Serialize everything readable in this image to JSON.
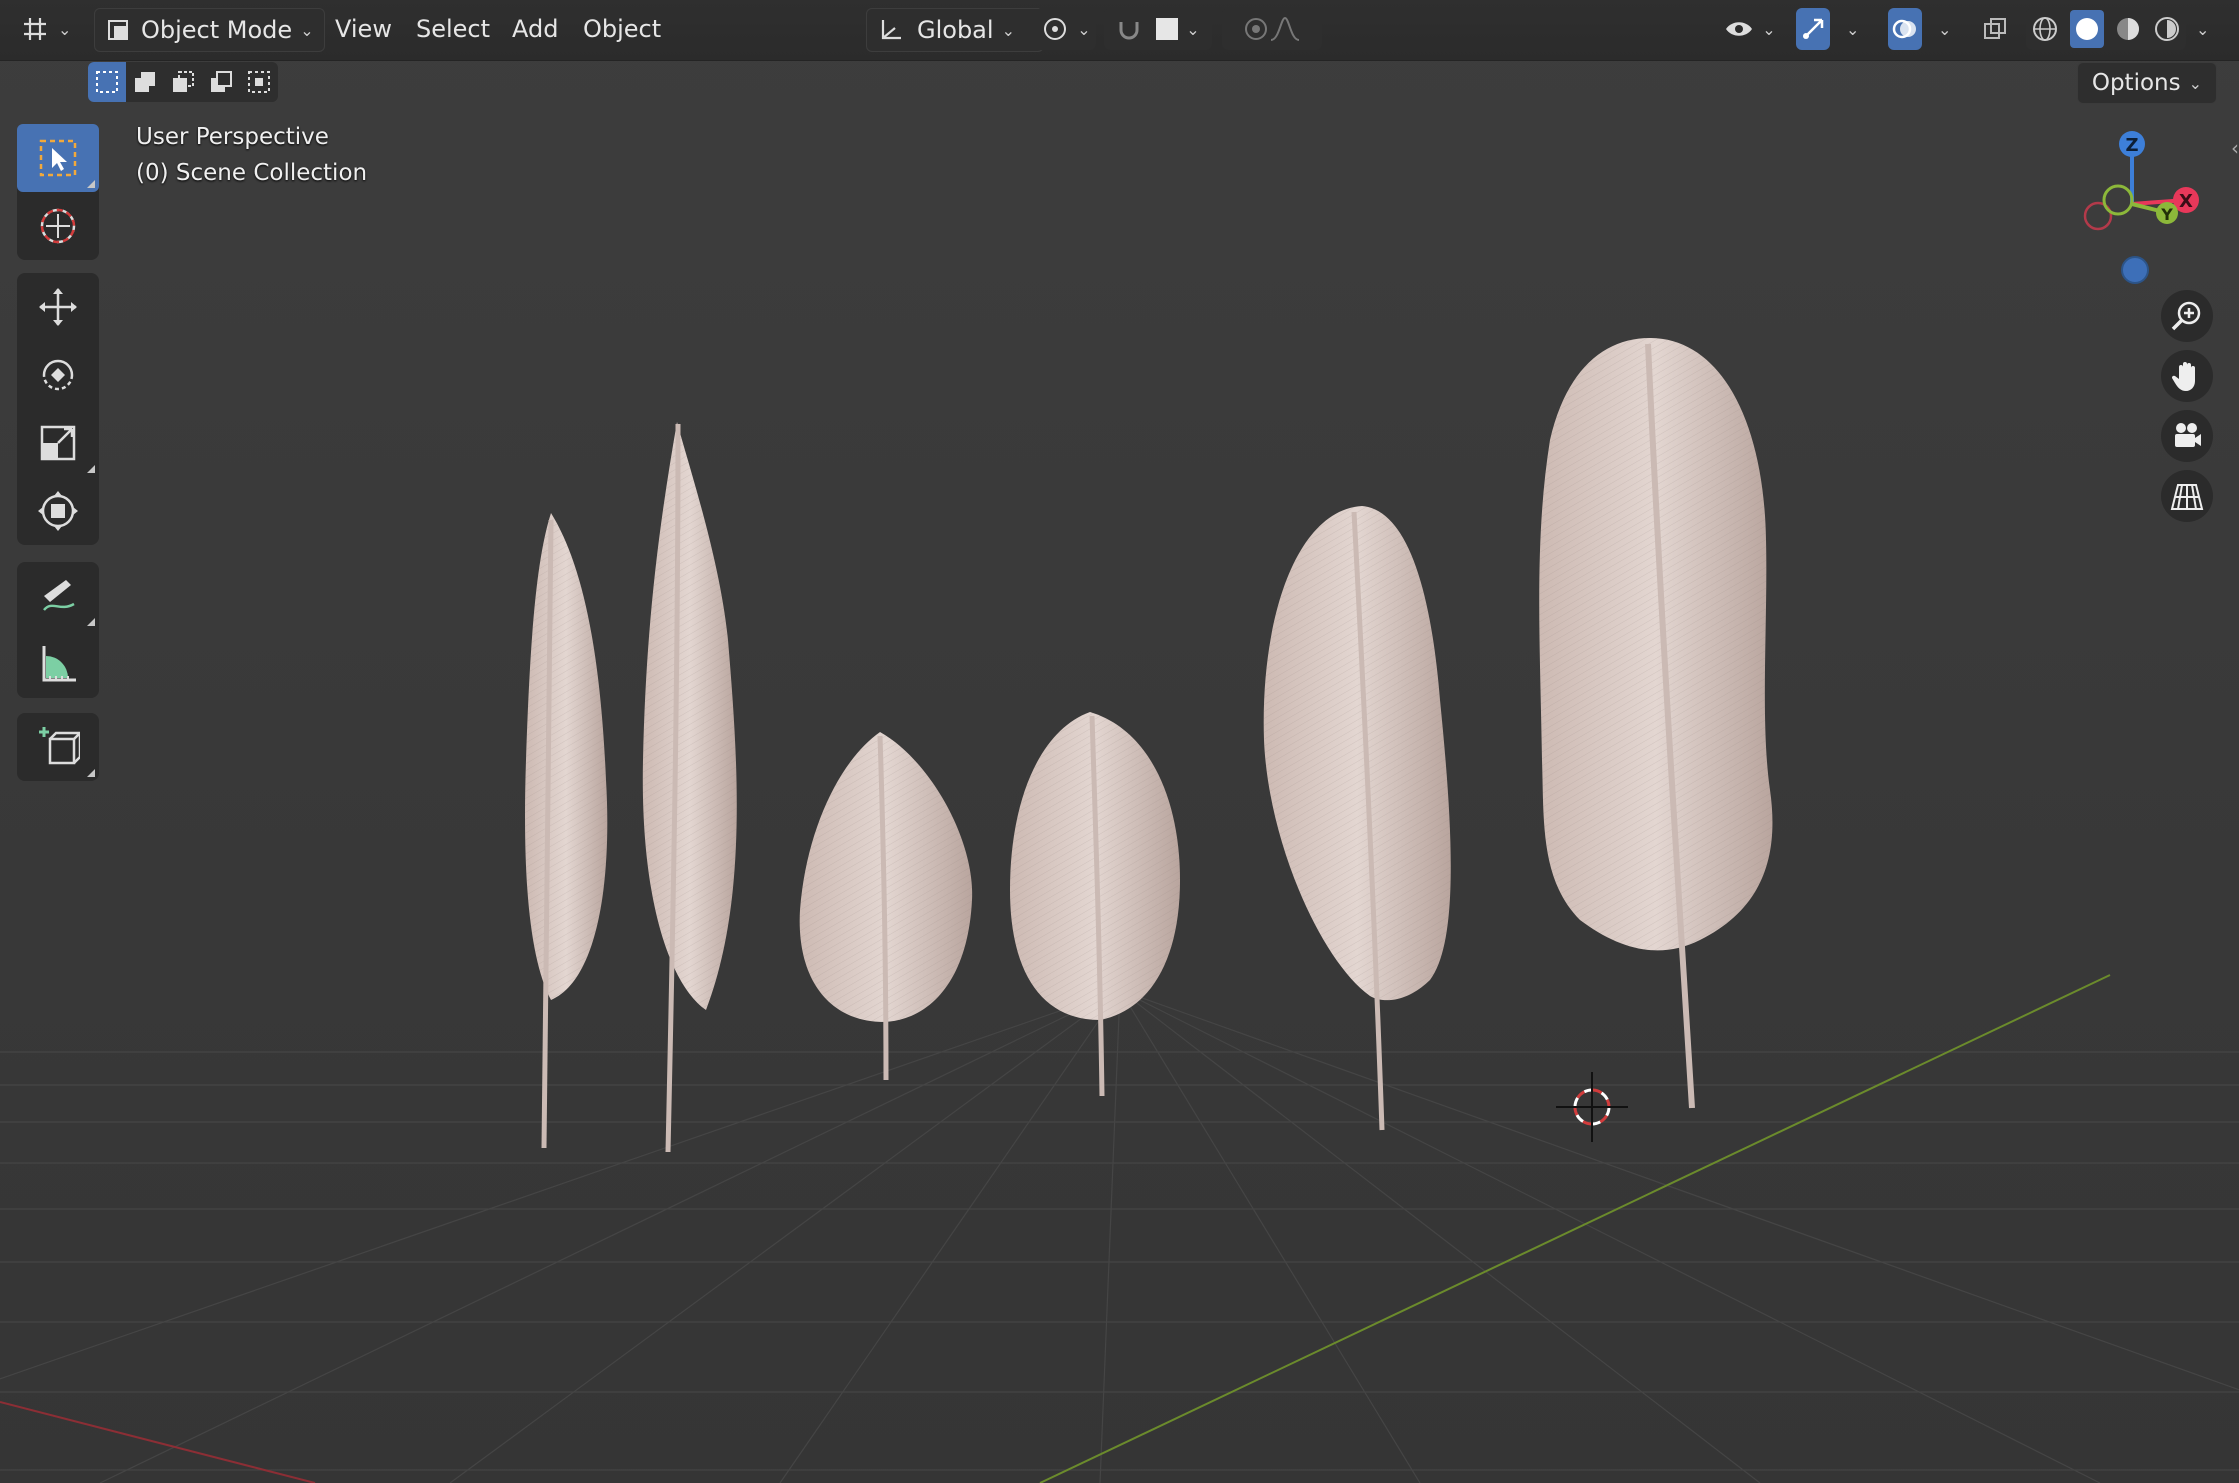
{
  "header": {
    "editor_type_icon": "grid-editor-icon",
    "mode": "Object Mode",
    "menus": [
      "View",
      "Select",
      "Add",
      "Object"
    ],
    "transform_orientation": "Global"
  },
  "options_label": "Options",
  "viewport": {
    "view_name": "User Perspective",
    "collection": "(0) Scene Collection"
  },
  "toolbar": {
    "tools": [
      "select-box-icon",
      "cursor-icon",
      "move-icon",
      "rotate-icon",
      "scale-icon",
      "transform-icon",
      "annotate-icon",
      "measure-icon",
      "add-cube-icon"
    ],
    "active_tool": "select-box-icon"
  },
  "gizmo": {
    "axes": {
      "z": "Z",
      "x": "X",
      "y": "Y"
    }
  },
  "colors": {
    "accent": "#4772b3",
    "axis_x": "#e8385a",
    "axis_y": "#8cb83a",
    "axis_z": "#3d7fd9",
    "feather": "#d8c8c2"
  }
}
